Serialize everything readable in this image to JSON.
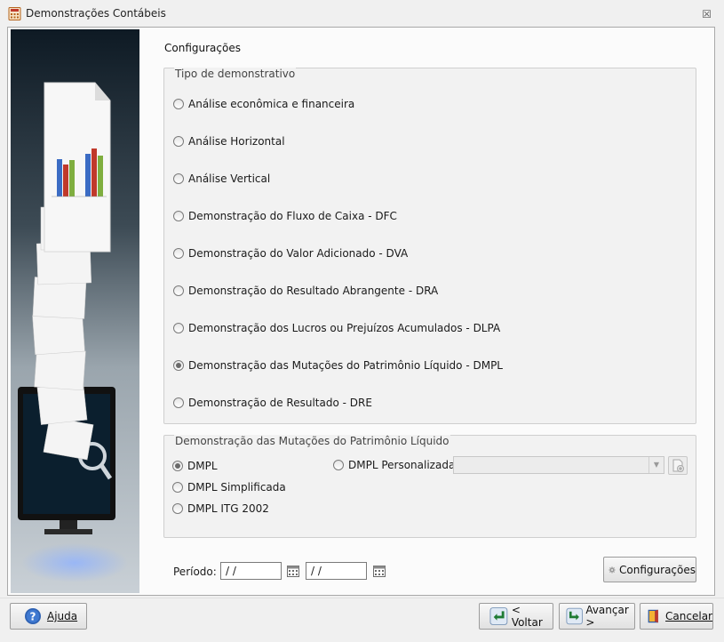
{
  "window": {
    "title": "Demonstrações Contábeis",
    "close": "☒"
  },
  "main": {
    "title": "Configurações"
  },
  "tipo": {
    "label": "Tipo de demonstrativo",
    "options": [
      {
        "label": "Análise econômica e financeira",
        "selected": false
      },
      {
        "label": "Análise Horizontal",
        "selected": false
      },
      {
        "label": "Análise Vertical",
        "selected": false
      },
      {
        "label": "Demonstração do Fluxo de Caixa - DFC",
        "selected": false
      },
      {
        "label": "Demonstração do Valor Adicionado - DVA",
        "selected": false
      },
      {
        "label": "Demonstração do Resultado Abrangente - DRA",
        "selected": false
      },
      {
        "label": "Demonstração dos Lucros ou Prejuízos Acumulados - DLPA",
        "selected": false
      },
      {
        "label": "Demonstração das Mutações do Patrimônio Líquido - DMPL",
        "selected": true
      },
      {
        "label": "Demonstração de Resultado - DRE",
        "selected": false
      }
    ]
  },
  "dmpl": {
    "label": "Demonstração das Mutações do Patrimônio Líquido",
    "options": [
      {
        "label": "DMPL",
        "selected": true
      },
      {
        "label": "DMPL Simplificada",
        "selected": false
      },
      {
        "label": "DMPL ITG 2002",
        "selected": false
      },
      {
        "label": "DMPL Personalizada",
        "selected": false
      }
    ],
    "combo_value": ""
  },
  "periodo": {
    "label": "Período:",
    "start": " /  /",
    "end": " /  /"
  },
  "buttons": {
    "configuracoes": "Configurações",
    "ajuda": "Ajuda",
    "voltar": "< Voltar",
    "avancar": "Avançar >",
    "cancelar": "Cancelar"
  }
}
